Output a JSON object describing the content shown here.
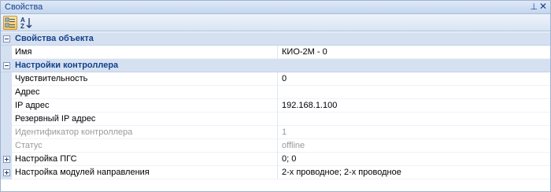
{
  "window": {
    "title": "Свойства",
    "pin_icon": "pin-icon",
    "close_icon": "close-icon"
  },
  "toolbar": {
    "buttons": [
      {
        "icon": "categorized-view-icon",
        "active": true
      },
      {
        "icon": "sort-alphabetical-icon",
        "active": false
      }
    ]
  },
  "categories": [
    {
      "label": "Свойства объекта",
      "expanded": true,
      "rows": [
        {
          "name": "Имя",
          "value": "КИО-2М - 0"
        }
      ]
    },
    {
      "label": "Настройки контроллера",
      "expanded": true,
      "rows": [
        {
          "name": "Чувствительность",
          "value": "0"
        },
        {
          "name": "Адрес",
          "value": ""
        },
        {
          "name": "IP адрес",
          "value": "192.168.1.100"
        },
        {
          "name": "Резервный IP адрес",
          "value": ""
        },
        {
          "name": "Идентификатор контроллера",
          "value": "1"
        },
        {
          "name": "Статус",
          "value": "offline"
        },
        {
          "name": "Настройка ПГС",
          "value": "0; 0"
        },
        {
          "name": "Настройка модулей направления",
          "value": "2-х проводное; 2-х проводное"
        }
      ]
    }
  ],
  "colors": {
    "category_bg": "#d5e1f1",
    "category_text": "#15428b",
    "disabled_text": "#9a9a9a"
  }
}
